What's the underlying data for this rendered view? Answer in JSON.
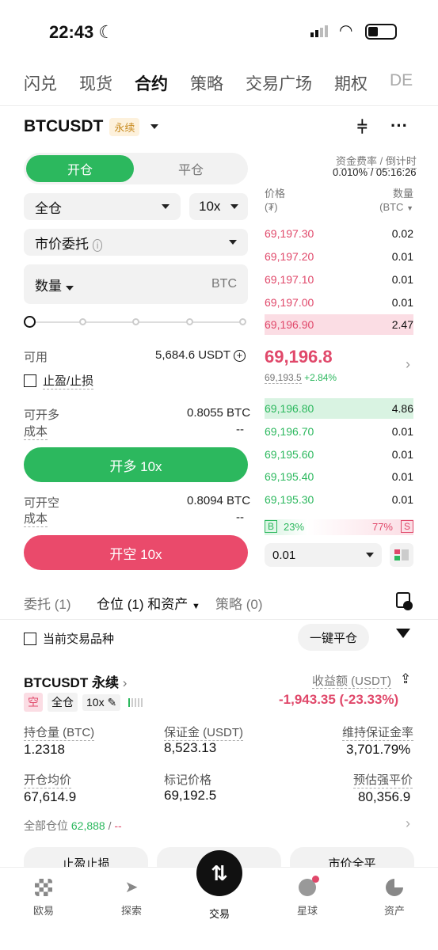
{
  "status": {
    "time": "22:43"
  },
  "nav": {
    "tabs": [
      "闪兑",
      "现货",
      "合约",
      "策略",
      "交易广场",
      "期权",
      "DE"
    ],
    "active_index": 2
  },
  "symbol": {
    "name": "BTCUSDT",
    "tag": "永续"
  },
  "order_form": {
    "tab_open": "开仓",
    "tab_close": "平仓",
    "margin_mode": "全仓",
    "leverage": "10x",
    "order_type": "市价委托",
    "qty_label": "数量",
    "qty_unit": "BTC",
    "available_label": "可用",
    "available_value": "5,684.6 USDT",
    "tpsl_label": "止盈/止损",
    "can_long_label": "可开多",
    "can_long_value": "0.8055 BTC",
    "cost_label": "成本",
    "cost_value": "--",
    "long_button": "开多 10x",
    "can_short_label": "可开空",
    "can_short_value": "0.8094 BTC",
    "cost_label_2": "成本",
    "cost_value_2": "--",
    "short_button": "开空 10x"
  },
  "funding": {
    "label": "资金费率 / 倒计时",
    "value": "0.010% / 05:16:26"
  },
  "orderbook": {
    "price_header": "价格",
    "price_unit": "(₮)",
    "qty_header": "数量",
    "qty_unit": "(BTC",
    "asks": [
      {
        "price": "69,197.30",
        "qty": "0.02"
      },
      {
        "price": "69,197.20",
        "qty": "0.01"
      },
      {
        "price": "69,197.10",
        "qty": "0.01"
      },
      {
        "price": "69,197.00",
        "qty": "0.01"
      },
      {
        "price": "69,196.90",
        "qty": "2.47"
      }
    ],
    "last_price": "69,196.8",
    "mark_price": "69,193.5",
    "change": "+2.84%",
    "bids": [
      {
        "price": "69,196.80",
        "qty": "4.86"
      },
      {
        "price": "69,196.70",
        "qty": "0.01"
      },
      {
        "price": "69,195.60",
        "qty": "0.01"
      },
      {
        "price": "69,195.40",
        "qty": "0.01"
      },
      {
        "price": "69,195.30",
        "qty": "0.01"
      }
    ],
    "buy_ratio_label": "B",
    "buy_ratio": "23%",
    "sell_ratio": "77%",
    "sell_ratio_label": "S",
    "precision": "0.01"
  },
  "positions_tabs": {
    "orders": "委托 (1)",
    "positions": "仓位 (1) 和资产",
    "strategies": "策略 (0)"
  },
  "filter": {
    "current_pair": "当前交易品种",
    "close_all": "一键平仓"
  },
  "position": {
    "symbol": "BTCUSDT 永续",
    "side": "空",
    "mode": "全仓",
    "leverage": "10x",
    "pnl_label": "收益额 (USDT)",
    "pnl_value": "-1,943.35 (-23.33%)",
    "size_label": "持仓量 (BTC)",
    "size_value": "1.2318",
    "margin_label": "保证金 (USDT)",
    "margin_value": "8,523.13",
    "mmr_label": "维持保证金率",
    "mmr_value": "3,701.79%",
    "entry_label": "开仓均价",
    "entry_value": "67,614.9",
    "mark_label": "标记价格",
    "mark_value": "69,192.5",
    "liq_label": "预估强平价",
    "liq_value": "80,356.9",
    "all_positions_label": "全部仓位",
    "all_positions_value": "62,888",
    "all_positions_extra": "--"
  },
  "action_buttons": [
    "止盈止损",
    "",
    "市价全平"
  ],
  "tabbar": [
    "欧易",
    "探索",
    "交易",
    "星球",
    "资产"
  ],
  "colors": {
    "green": "#2cb85e",
    "red": "#e0486a"
  }
}
